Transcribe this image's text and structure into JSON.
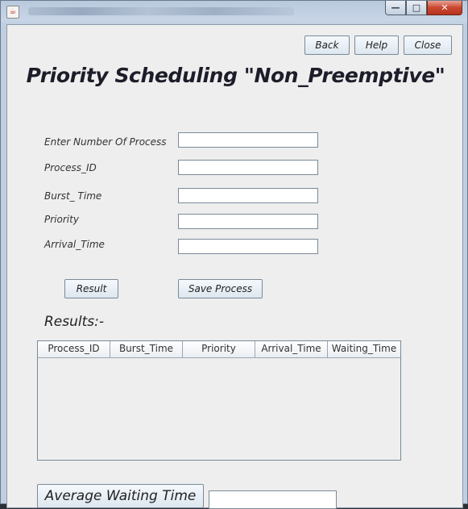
{
  "window": {
    "icon": "java-cup-icon",
    "captions": {
      "minimize": "—",
      "maximize": "□",
      "close": "✕"
    }
  },
  "toolbar": {
    "back_label": "Back",
    "help_label": "Help",
    "close_label": "Close"
  },
  "heading": "Priority Scheduling \"Non_Preemptive\"",
  "form": {
    "num_process_label": "Enter Number Of Process",
    "process_id_label": "Process_ID",
    "burst_time_label": "Burst_ Time",
    "priority_label": "Priority",
    "arrival_time_label": "Arrival_Time",
    "num_process_value": "",
    "process_id_value": "",
    "burst_time_value": "",
    "priority_value": "",
    "arrival_time_value": ""
  },
  "actions": {
    "result_label": "Result",
    "save_label": "Save Process"
  },
  "results": {
    "title": "Results:-",
    "columns": [
      "Process_ID",
      "Burst_Time",
      "Priority",
      "Arrival_Time",
      "Waiting_Time"
    ],
    "rows": []
  },
  "average": {
    "button_label": "Average Waiting Time",
    "value": ""
  }
}
